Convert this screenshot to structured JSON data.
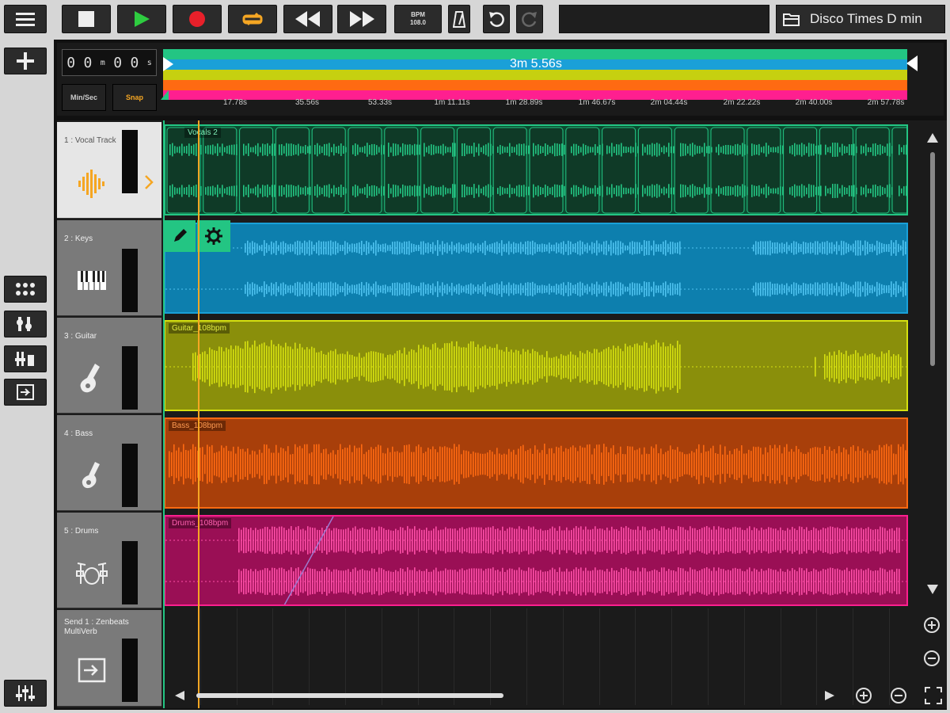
{
  "toolbar": {
    "bpm_label": "BPM",
    "bpm_value": "108.0",
    "project_name": "Disco Times D min"
  },
  "transport": {
    "counter": [
      "0",
      "0",
      "m",
      "0",
      "0",
      "s"
    ],
    "minsec_label": "Min/Sec",
    "snap_label": "Snap",
    "duration_label": "3m 5.56s",
    "ruler_marks": [
      "17.78s",
      "35.56s",
      "53.33s",
      "1m 11.11s",
      "1m 28.89s",
      "1m 46.67s",
      "2m 04.44s",
      "2m 22.22s",
      "2m 40.00s",
      "2m 57.78s"
    ]
  },
  "tracks": [
    {
      "name": "1 : Vocal Track",
      "icon": "waveform-icon",
      "clip_label": "Vocals 2",
      "color": "#23c583",
      "clip_bg": "#0b4a30",
      "selected": true
    },
    {
      "name": "2 : Keys",
      "icon": "piano-icon",
      "clip_label": "",
      "color": "#1aa0d8",
      "clip_bg": "#0d7fae",
      "selected": false
    },
    {
      "name": "3 : Guitar",
      "icon": "guitar-icon",
      "clip_label": "Guitar_108bpm",
      "color": "#d6e010",
      "clip_bg": "#8a8f0b",
      "selected": false
    },
    {
      "name": "4 : Bass",
      "icon": "bass-icon",
      "clip_label": "Bass_108bpm",
      "color": "#ff6a12",
      "clip_bg": "#a83f0a",
      "selected": false
    },
    {
      "name": "5 : Drums",
      "icon": "drums-icon",
      "clip_label": "Drums_108bpm",
      "color": "#ff1f8f",
      "clip_bg": "#9a0f55",
      "selected": false
    }
  ],
  "send": {
    "name": "Send 1 : Zenbeats MultiVerb",
    "icon": "send-icon"
  },
  "colors": {
    "accent": "#ffa500",
    "play": "#2ecc40",
    "record": "#e8202a",
    "loop": "#f5a623"
  }
}
